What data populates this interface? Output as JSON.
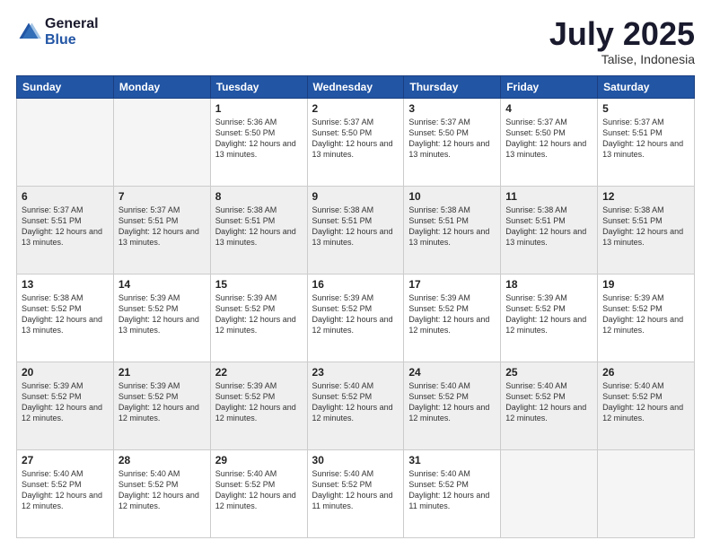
{
  "logo": {
    "line1": "General",
    "line2": "Blue"
  },
  "title": "July 2025",
  "location": "Talise, Indonesia",
  "days_header": [
    "Sunday",
    "Monday",
    "Tuesday",
    "Wednesday",
    "Thursday",
    "Friday",
    "Saturday"
  ],
  "weeks": [
    [
      {
        "day": "",
        "info": ""
      },
      {
        "day": "",
        "info": ""
      },
      {
        "day": "1",
        "info": "Sunrise: 5:36 AM\nSunset: 5:50 PM\nDaylight: 12 hours and 13 minutes."
      },
      {
        "day": "2",
        "info": "Sunrise: 5:37 AM\nSunset: 5:50 PM\nDaylight: 12 hours and 13 minutes."
      },
      {
        "day": "3",
        "info": "Sunrise: 5:37 AM\nSunset: 5:50 PM\nDaylight: 12 hours and 13 minutes."
      },
      {
        "day": "4",
        "info": "Sunrise: 5:37 AM\nSunset: 5:50 PM\nDaylight: 12 hours and 13 minutes."
      },
      {
        "day": "5",
        "info": "Sunrise: 5:37 AM\nSunset: 5:51 PM\nDaylight: 12 hours and 13 minutes."
      }
    ],
    [
      {
        "day": "6",
        "info": "Sunrise: 5:37 AM\nSunset: 5:51 PM\nDaylight: 12 hours and 13 minutes."
      },
      {
        "day": "7",
        "info": "Sunrise: 5:37 AM\nSunset: 5:51 PM\nDaylight: 12 hours and 13 minutes."
      },
      {
        "day": "8",
        "info": "Sunrise: 5:38 AM\nSunset: 5:51 PM\nDaylight: 12 hours and 13 minutes."
      },
      {
        "day": "9",
        "info": "Sunrise: 5:38 AM\nSunset: 5:51 PM\nDaylight: 12 hours and 13 minutes."
      },
      {
        "day": "10",
        "info": "Sunrise: 5:38 AM\nSunset: 5:51 PM\nDaylight: 12 hours and 13 minutes."
      },
      {
        "day": "11",
        "info": "Sunrise: 5:38 AM\nSunset: 5:51 PM\nDaylight: 12 hours and 13 minutes."
      },
      {
        "day": "12",
        "info": "Sunrise: 5:38 AM\nSunset: 5:51 PM\nDaylight: 12 hours and 13 minutes."
      }
    ],
    [
      {
        "day": "13",
        "info": "Sunrise: 5:38 AM\nSunset: 5:52 PM\nDaylight: 12 hours and 13 minutes."
      },
      {
        "day": "14",
        "info": "Sunrise: 5:39 AM\nSunset: 5:52 PM\nDaylight: 12 hours and 13 minutes."
      },
      {
        "day": "15",
        "info": "Sunrise: 5:39 AM\nSunset: 5:52 PM\nDaylight: 12 hours and 12 minutes."
      },
      {
        "day": "16",
        "info": "Sunrise: 5:39 AM\nSunset: 5:52 PM\nDaylight: 12 hours and 12 minutes."
      },
      {
        "day": "17",
        "info": "Sunrise: 5:39 AM\nSunset: 5:52 PM\nDaylight: 12 hours and 12 minutes."
      },
      {
        "day": "18",
        "info": "Sunrise: 5:39 AM\nSunset: 5:52 PM\nDaylight: 12 hours and 12 minutes."
      },
      {
        "day": "19",
        "info": "Sunrise: 5:39 AM\nSunset: 5:52 PM\nDaylight: 12 hours and 12 minutes."
      }
    ],
    [
      {
        "day": "20",
        "info": "Sunrise: 5:39 AM\nSunset: 5:52 PM\nDaylight: 12 hours and 12 minutes."
      },
      {
        "day": "21",
        "info": "Sunrise: 5:39 AM\nSunset: 5:52 PM\nDaylight: 12 hours and 12 minutes."
      },
      {
        "day": "22",
        "info": "Sunrise: 5:39 AM\nSunset: 5:52 PM\nDaylight: 12 hours and 12 minutes."
      },
      {
        "day": "23",
        "info": "Sunrise: 5:40 AM\nSunset: 5:52 PM\nDaylight: 12 hours and 12 minutes."
      },
      {
        "day": "24",
        "info": "Sunrise: 5:40 AM\nSunset: 5:52 PM\nDaylight: 12 hours and 12 minutes."
      },
      {
        "day": "25",
        "info": "Sunrise: 5:40 AM\nSunset: 5:52 PM\nDaylight: 12 hours and 12 minutes."
      },
      {
        "day": "26",
        "info": "Sunrise: 5:40 AM\nSunset: 5:52 PM\nDaylight: 12 hours and 12 minutes."
      }
    ],
    [
      {
        "day": "27",
        "info": "Sunrise: 5:40 AM\nSunset: 5:52 PM\nDaylight: 12 hours and 12 minutes."
      },
      {
        "day": "28",
        "info": "Sunrise: 5:40 AM\nSunset: 5:52 PM\nDaylight: 12 hours and 12 minutes."
      },
      {
        "day": "29",
        "info": "Sunrise: 5:40 AM\nSunset: 5:52 PM\nDaylight: 12 hours and 12 minutes."
      },
      {
        "day": "30",
        "info": "Sunrise: 5:40 AM\nSunset: 5:52 PM\nDaylight: 12 hours and 11 minutes."
      },
      {
        "day": "31",
        "info": "Sunrise: 5:40 AM\nSunset: 5:52 PM\nDaylight: 12 hours and 11 minutes."
      },
      {
        "day": "",
        "info": ""
      },
      {
        "day": "",
        "info": ""
      }
    ]
  ]
}
